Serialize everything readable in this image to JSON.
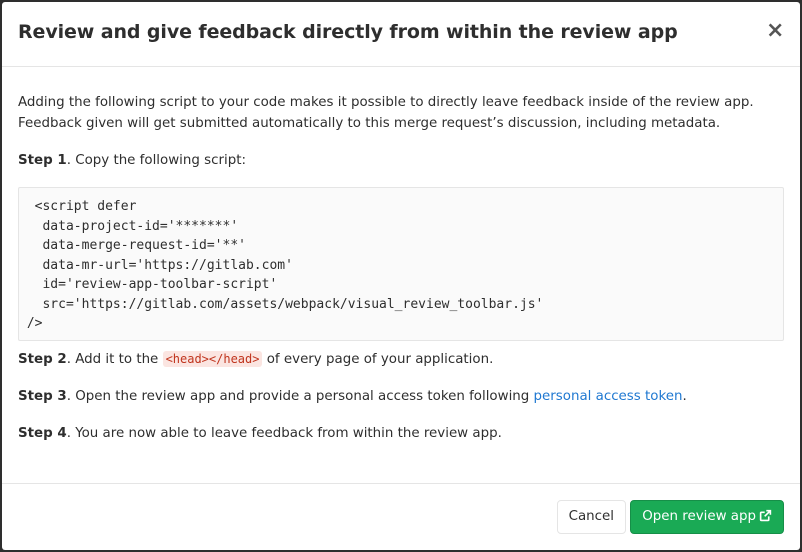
{
  "modal": {
    "title": "Review and give feedback directly from within the review app",
    "close_label": "×"
  },
  "body": {
    "intro": "Adding the following script to your code makes it possible to directly leave feedback inside of the review app. Feedback given will get submitted automatically to this merge request’s discussion, including metadata.",
    "step1": {
      "label": "Step 1",
      "text": ". Copy the following script:"
    },
    "code_lines": [
      "  <script defer",
      "   data-project-id='*******'",
      "   data-merge-request-id='**'",
      "   data-mr-url='https://gitlab.com'",
      "   id='review-app-toolbar-script'",
      "   src='https://gitlab.com/assets/webpack/visual_review_toolbar.js'",
      " />"
    ],
    "step2": {
      "label": "Step 2",
      "text_before": ". Add it to the ",
      "code": "<head></head>",
      "text_after": " of every page of your application."
    },
    "step3": {
      "label": "Step 3",
      "text": ". Open the review app and provide a personal access token following ",
      "link": "personal access token",
      "text_after": "."
    },
    "step4": {
      "label": "Step 4",
      "text": ". You are now able to leave feedback from within the review app."
    }
  },
  "footer": {
    "cancel_label": "Cancel",
    "primary_label": "Open review app",
    "primary_icon": "external-link-icon"
  },
  "colors": {
    "primary": "#1aaa55",
    "link": "#1f78d1",
    "inline_code_text": "#c0341d",
    "inline_code_bg": "#fbe5e1"
  }
}
